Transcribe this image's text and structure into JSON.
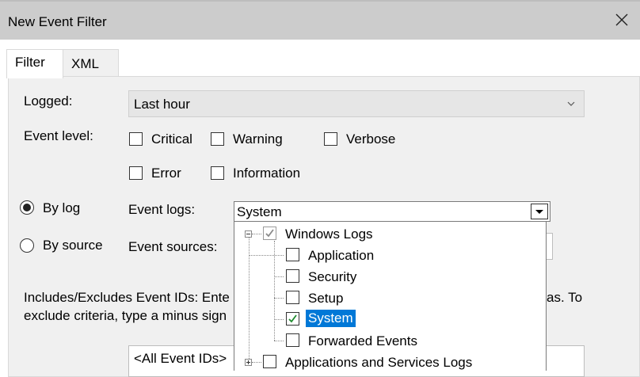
{
  "window": {
    "title": "New Event Filter"
  },
  "tabs": [
    {
      "label": "Filter"
    },
    {
      "label": "XML"
    }
  ],
  "filter": {
    "logged_label": "Logged:",
    "logged_value": "Last hour",
    "event_level_label": "Event level:",
    "levels": [
      {
        "label": "Critical",
        "checked": false
      },
      {
        "label": "Warning",
        "checked": false
      },
      {
        "label": "Verbose",
        "checked": false
      },
      {
        "label": "Error",
        "checked": false
      },
      {
        "label": "Information",
        "checked": false
      }
    ],
    "by_log_label": "By log",
    "by_source_label": "By source",
    "event_logs_label": "Event logs:",
    "event_logs_value": "System",
    "event_sources_label": "Event sources:",
    "includes_text_1": "Includes/Excludes Event IDs: Ente",
    "includes_text_1b": "as. To",
    "includes_text_2": "exclude criteria, type a minus sign",
    "event_ids_value": "<All Event IDs>"
  },
  "tree": [
    {
      "label": "Windows Logs",
      "checked": true,
      "partial": true
    },
    {
      "label": "Application",
      "checked": false
    },
    {
      "label": "Security",
      "checked": false
    },
    {
      "label": "Setup",
      "checked": false
    },
    {
      "label": "System",
      "checked": true,
      "selected": true
    },
    {
      "label": "Forwarded Events",
      "checked": false
    },
    {
      "label": "Applications and Services Logs",
      "checked": false
    }
  ],
  "colors": {
    "selection": "#0078d7",
    "check_green": "#1e8b2d",
    "check_grey": "#8a8a8a"
  }
}
